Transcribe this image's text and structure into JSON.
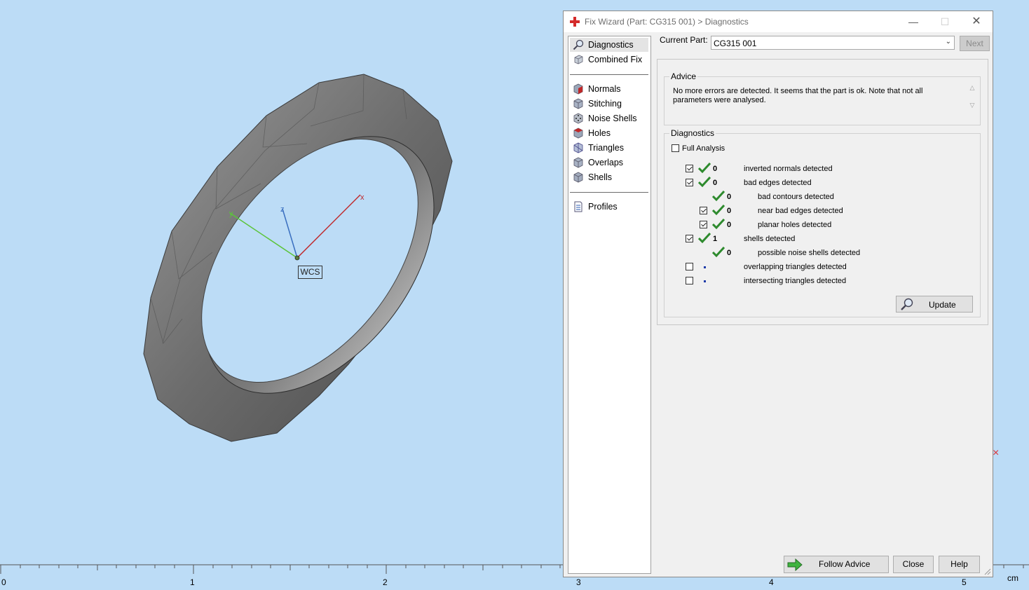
{
  "dialog": {
    "title": "Fix Wizard (Part: CG315 001) > Diagnostics",
    "current_part_label": "Current Part:",
    "current_part_value": "CG315 001",
    "next_label": "Next",
    "window_controls": {
      "minimize": "—",
      "maximize": "☐",
      "close": "✕"
    }
  },
  "nav": {
    "items": [
      {
        "label": "Diagnostics",
        "icon": "magnifier-icon",
        "selected": true
      },
      {
        "label": "Combined Fix",
        "icon": "cube-icon",
        "selected": false
      },
      {
        "label": "Normals",
        "icon": "normals-cube-icon",
        "selected": false
      },
      {
        "label": "Stitching",
        "icon": "stitching-cube-icon",
        "selected": false
      },
      {
        "label": "Noise Shells",
        "icon": "noise-dice-icon",
        "selected": false
      },
      {
        "label": "Holes",
        "icon": "holes-cube-icon",
        "selected": false
      },
      {
        "label": "Triangles",
        "icon": "triangles-cube-icon",
        "selected": false
      },
      {
        "label": "Overlaps",
        "icon": "overlaps-cube-icon",
        "selected": false
      },
      {
        "label": "Shells",
        "icon": "shells-cube-icon",
        "selected": false
      },
      {
        "label": "Profiles",
        "icon": "document-icon",
        "selected": false
      }
    ]
  },
  "advice": {
    "title": "Advice",
    "text": "No more errors are detected. It seems that the part is ok. Note that not all parameters were analysed."
  },
  "diagnostics": {
    "title": "Diagnostics",
    "full_analysis_label": "Full Analysis",
    "full_analysis_checked": false,
    "rows": [
      {
        "label": "inverted normals detected",
        "count": "0",
        "checked": true,
        "status": "ok"
      },
      {
        "label": "bad edges detected",
        "count": "0",
        "checked": true,
        "status": "ok"
      },
      {
        "label": "bad contours detected",
        "count": "0",
        "checked": null,
        "status": "ok"
      },
      {
        "label": "near bad edges detected",
        "count": "0",
        "checked": true,
        "status": "ok"
      },
      {
        "label": "planar holes detected",
        "count": "0",
        "checked": true,
        "status": "ok"
      },
      {
        "label": "shells detected",
        "count": "1",
        "checked": true,
        "status": "ok"
      },
      {
        "label": "possible noise shells detected",
        "count": "0",
        "checked": null,
        "status": "ok"
      },
      {
        "label": "overlapping triangles detected",
        "count": "",
        "checked": false,
        "status": "not-analysed"
      },
      {
        "label": "intersecting triangles detected",
        "count": "",
        "checked": false,
        "status": "not-analysed"
      }
    ],
    "update_label": "Update"
  },
  "buttons": {
    "follow_advice": "Follow Advice",
    "close": "Close",
    "help": "Help"
  },
  "viewport": {
    "wcs_label": "WCS",
    "axis_x": "x",
    "axis_y": "y",
    "axis_z": "z",
    "ruler_labels": [
      "0",
      "1",
      "2",
      "3",
      "4",
      "5"
    ],
    "ruler_unit": "cm",
    "marker": "×"
  },
  "colors": {
    "background": "#bcdcf6",
    "ok_green": "#2d8a2d",
    "axis_x": "#c0282a",
    "axis_y": "#5cc43a",
    "axis_z": "#3a6fc0"
  }
}
